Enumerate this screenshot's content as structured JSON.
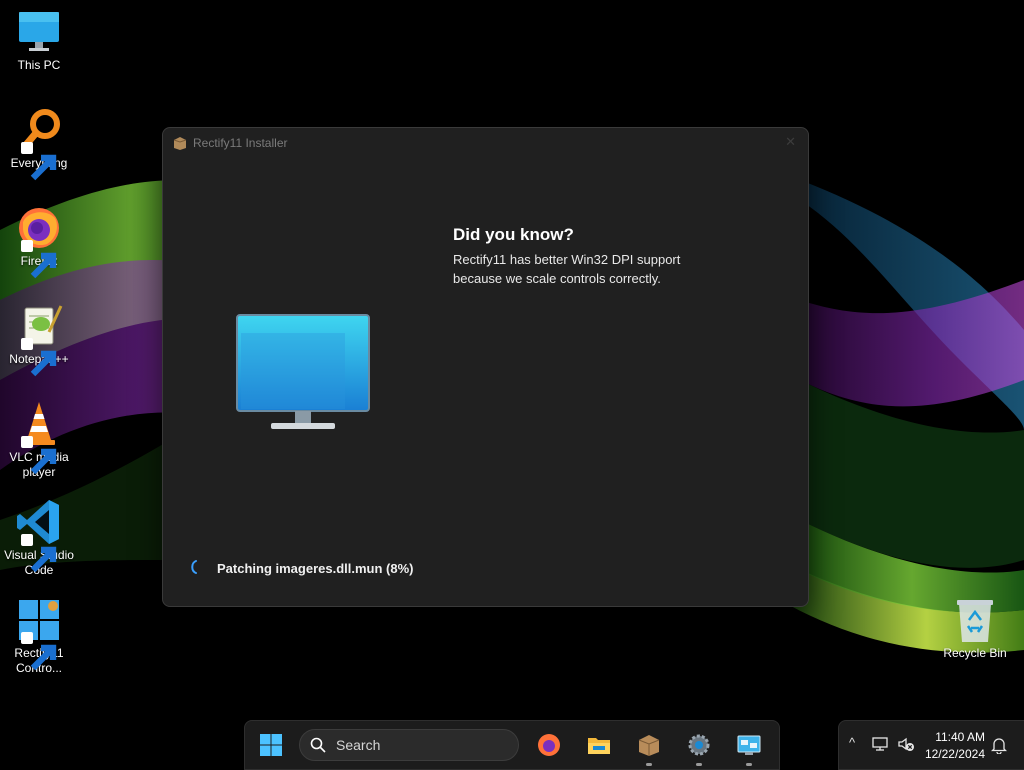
{
  "desktop": {
    "icons": [
      {
        "label": "This PC",
        "icon": "computer-icon"
      },
      {
        "label": "Everything",
        "icon": "everything-search-icon"
      },
      {
        "label": "Firefox",
        "icon": "firefox-icon"
      },
      {
        "label": "Notepad++",
        "icon": "notepad-plus-plus-icon"
      },
      {
        "label": "VLC media player",
        "icon": "vlc-cone-icon"
      },
      {
        "label": "Visual Studio Code",
        "icon": "vscode-icon"
      },
      {
        "label": "Rectify11 Contro...",
        "icon": "rectify11-control-center-icon"
      },
      {
        "label": "Recycle Bin",
        "icon": "recycle-bin-icon"
      }
    ]
  },
  "installer": {
    "title": "Rectify11 Installer",
    "close_glyph": "✕",
    "tip_heading": "Did you know?",
    "tip_body": "Rectify11 has better Win32 DPI support because we scale controls correctly.",
    "status": "Patching imageres.dll.mun (8%)",
    "progress_percent": 8
  },
  "taskbar": {
    "search_placeholder": "Search",
    "pinned": [
      "start-button",
      "search-box",
      "firefox",
      "file-explorer",
      "rectify11-installer",
      "settings",
      "control-panel"
    ]
  },
  "tray": {
    "chevron": "^",
    "time": "11:40 AM",
    "date": "12/22/2024"
  },
  "colors": {
    "window_bg": "#202020",
    "taskbar_bg": "#1c1c1c",
    "accent": "#0078d4"
  }
}
